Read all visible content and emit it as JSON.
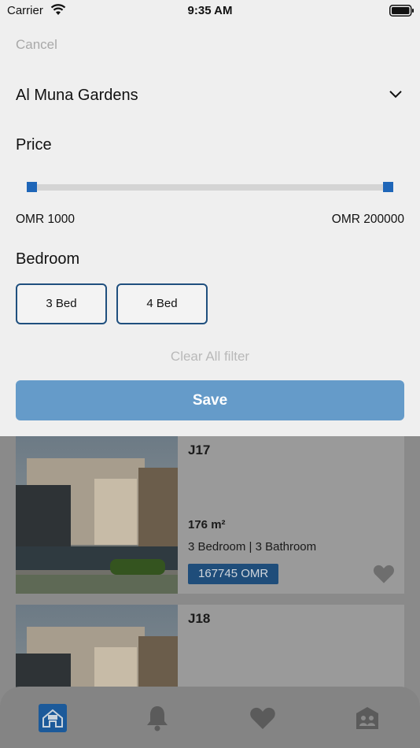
{
  "status_bar": {
    "carrier": "Carrier",
    "time": "9:35 AM"
  },
  "filter": {
    "cancel_label": "Cancel",
    "project": "Al Muna Gardens",
    "price_title": "Price",
    "price_min": "OMR 1000",
    "price_max": "OMR 200000",
    "slider_range_fraction": [
      0,
      1
    ],
    "bedroom_title": "Bedroom",
    "bedroom_options": [
      "3 Bed",
      "4 Bed"
    ],
    "clear_label": "Clear All filter",
    "save_label": "Save"
  },
  "listings": [
    {
      "title": "J17",
      "area": "176 m²",
      "rooms": "3 Bedroom | 3 Bathroom",
      "price": "167745 OMR"
    },
    {
      "title": "J18"
    }
  ],
  "tab_bar": {
    "icons": [
      "home-icon",
      "bell-icon",
      "heart-icon",
      "contacts-icon"
    ],
    "selected": "home-icon"
  },
  "colors": {
    "accent": "#1f66b8",
    "save_button": "#659bc9",
    "price_badge": "#1f4d7a",
    "bed_button_border": "#1f4f7e"
  }
}
